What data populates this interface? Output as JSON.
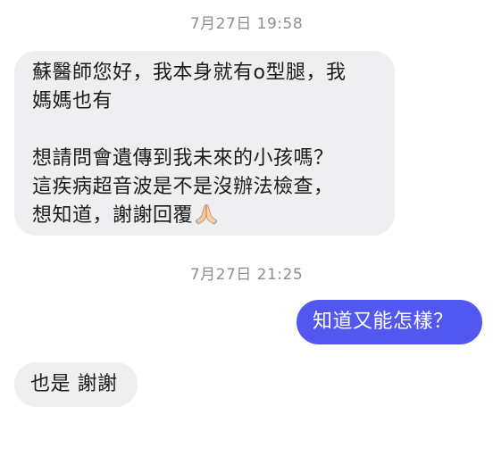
{
  "conversation": {
    "timestamp_1": "7月27日 19:58",
    "message_1": {
      "text": "蘇醫師您好，我本身就有o型腿，我\n媽媽也有\n\n想請問會遺傳到我未來的小孩嗎？\n這疾病超音波是不是沒辦法檢查，\n想知道，謝謝回覆",
      "emoji": "folded-hands"
    },
    "timestamp_2": "7月27日 21:25",
    "message_2": {
      "text": "知道又能怎樣？"
    },
    "message_3": {
      "text": "也是 謝謝"
    }
  },
  "colors": {
    "incoming_bubble": "#efeff1",
    "outgoing_bubble": "#5257f0",
    "timestamp_text": "#8e8e93"
  }
}
